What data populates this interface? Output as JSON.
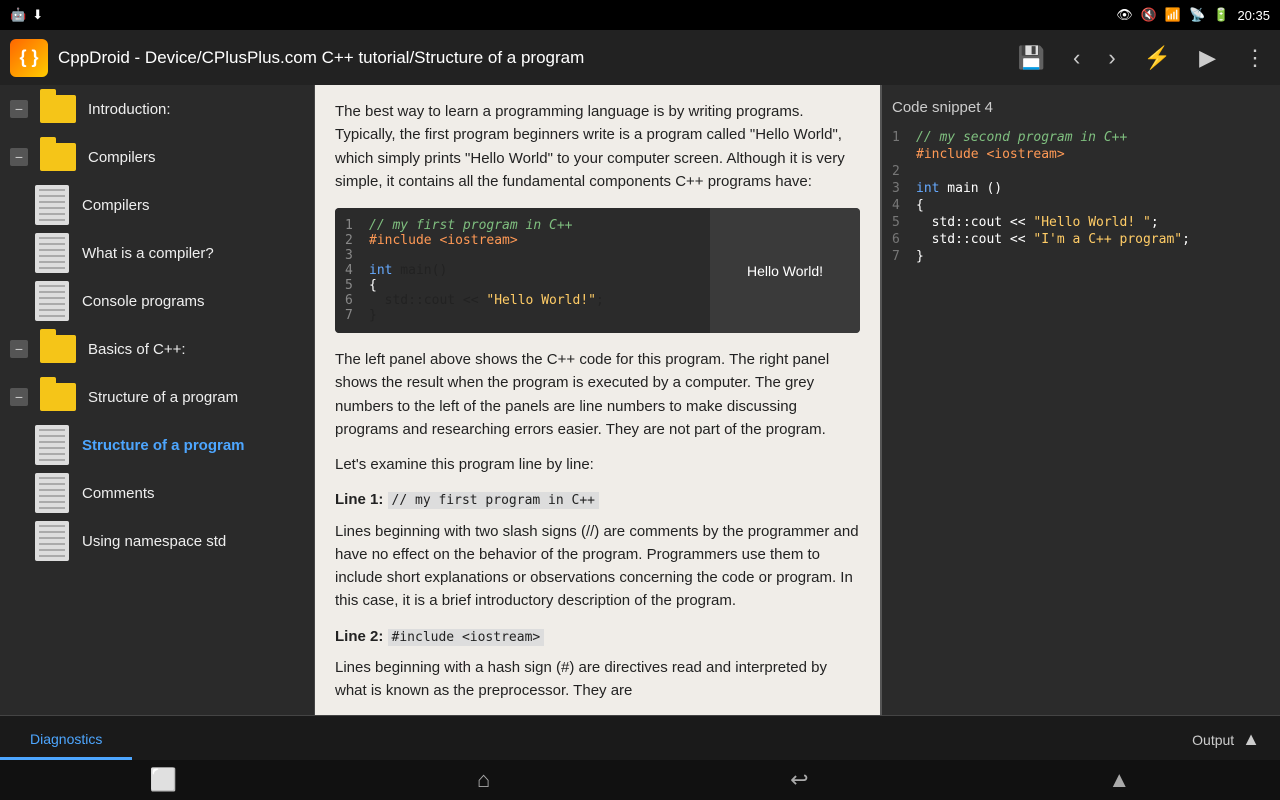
{
  "statusBar": {
    "leftIcons": [
      "android-icon",
      "notification-icon"
    ],
    "rightIcons": [
      "eye-icon",
      "mute-icon",
      "wifi-icon",
      "signal-icon",
      "battery-icon"
    ],
    "time": "20:35"
  },
  "titleBar": {
    "appName": "{ }",
    "title": "CppDroid - Device/CPlusPlus.com C++ tutorial/Structure of a program",
    "actions": [
      "save",
      "back",
      "forward",
      "lightning",
      "play",
      "menu"
    ]
  },
  "sidebar": {
    "sections": [
      {
        "id": "introduction",
        "label": "Introduction:",
        "type": "folder",
        "expanded": true,
        "indent": 0
      },
      {
        "id": "compilers-folder",
        "label": "Compilers",
        "type": "folder",
        "expanded": true,
        "indent": 0
      },
      {
        "id": "compilers-doc",
        "label": "Compilers",
        "type": "doc",
        "indent": 1
      },
      {
        "id": "what-is-compiler",
        "label": "What is a compiler?",
        "type": "doc",
        "indent": 1
      },
      {
        "id": "console-programs",
        "label": "Console programs",
        "type": "doc",
        "indent": 1
      },
      {
        "id": "basics-folder",
        "label": "Basics of C++:",
        "type": "folder",
        "expanded": true,
        "indent": 0
      },
      {
        "id": "structure-folder",
        "label": "Structure of a program",
        "type": "folder",
        "expanded": true,
        "indent": 0
      },
      {
        "id": "structure-doc",
        "label": "Structure of a program",
        "type": "doc",
        "active": true,
        "indent": 1
      },
      {
        "id": "comments-doc",
        "label": "Comments",
        "type": "doc",
        "indent": 1
      },
      {
        "id": "namespace-doc",
        "label": "Using namespace std",
        "type": "doc",
        "indent": 1
      }
    ]
  },
  "content": {
    "intro": "The best way to learn a programming language is by writing programs. Typically, the first program beginners write is a program called \"Hello World\", which simply prints \"Hello World\" to your computer screen. Although it is very simple, it contains all the fundamental components C++ programs have:",
    "codeLines": [
      {
        "num": "1",
        "text": "// my first program in C++",
        "type": "comment"
      },
      {
        "num": "2",
        "text": "#include <iostream>",
        "type": "include"
      },
      {
        "num": "3",
        "text": "",
        "type": "blank"
      },
      {
        "num": "4",
        "text": "int main()",
        "type": "normal"
      },
      {
        "num": "5",
        "text": "{",
        "type": "normal"
      },
      {
        "num": "6",
        "text": "   std::cout << \"Hello World!\";",
        "type": "normal"
      },
      {
        "num": "7",
        "text": "}",
        "type": "normal"
      }
    ],
    "codeOutput": "Hello World!",
    "desc1": "The left panel above shows the C++ code for this program. The right panel shows the result when the program is executed by a computer. The grey numbers to the left of the panels are line numbers to make discussing programs and researching errors easier. They are not part of the program.",
    "examineText": "Let's examine this program line by line:",
    "line1Label": "Line 1:",
    "line1Code": "// my first program in C++",
    "line1Desc": "Lines beginning with two slash signs (//) are comments by the programmer and have no effect on the behavior of the program. Programmers use them to include short explanations or observations concerning the code or program. In this case, it is a brief introductory description of the program.",
    "line2Label": "Line 2:",
    "line2Code": "#include <iostream>",
    "line2Desc": "Lines beginning with a hash sign (#) are directives read and interpreted by what is known as the preprocessor. They are"
  },
  "snippet": {
    "title": "Code snippet 4",
    "lines": [
      {
        "num": "1",
        "text": "// my second program in C++",
        "type": "comment"
      },
      {
        "num": "",
        "text": "#include <iostream>",
        "type": "include"
      },
      {
        "num": "2",
        "text": "",
        "type": "blank"
      },
      {
        "num": "3",
        "text": "int main ()",
        "type": "normal"
      },
      {
        "num": "4",
        "text": "{",
        "type": "normal"
      },
      {
        "num": "5",
        "text": "   std::cout << \"Hello World! \";",
        "type": "normal"
      },
      {
        "num": "6",
        "text": "   std::cout << \"I'm a C++ program\";",
        "type": "normal"
      },
      {
        "num": "7",
        "text": "}",
        "type": "normal"
      }
    ]
  },
  "bottomTabs": {
    "diagnostics": "Diagnostics",
    "output": "Output"
  },
  "navBar": {
    "recents": "⬜",
    "home": "⌂",
    "back": "↩",
    "up": "▲"
  }
}
